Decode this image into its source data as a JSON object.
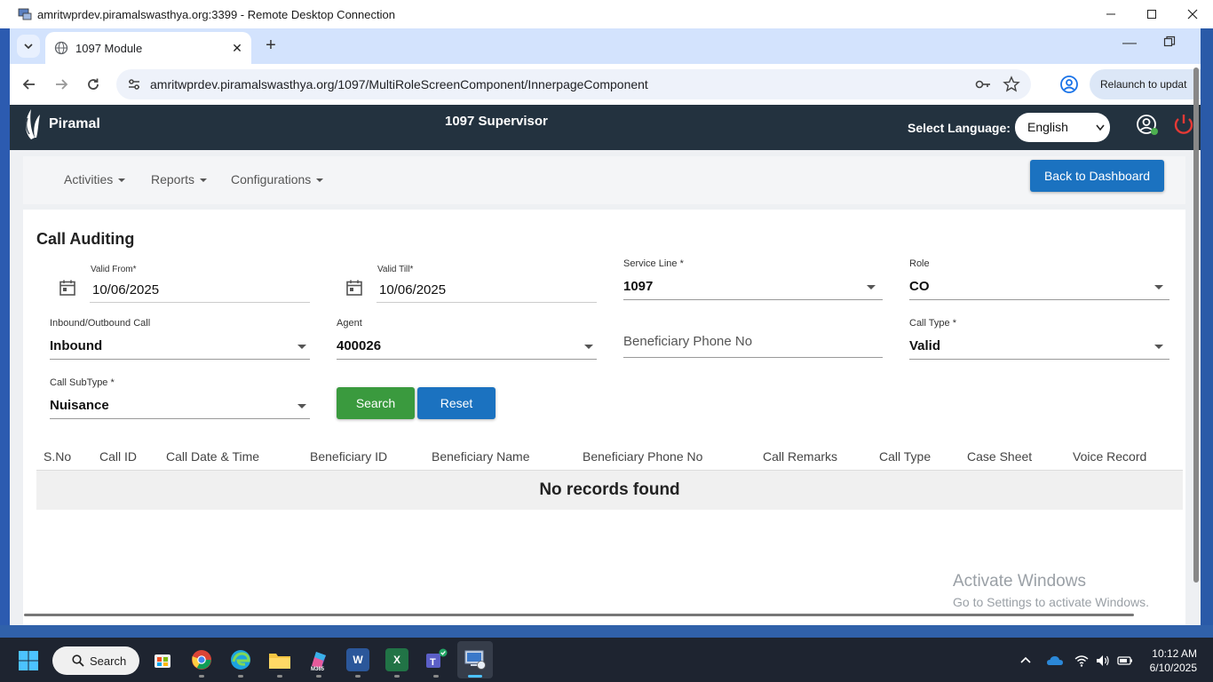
{
  "rdp_window": {
    "title": "amritwprdev.piramalswasthya.org:3399 - Remote Desktop Connection"
  },
  "browser": {
    "tab_title": "1097 Module",
    "url": "amritwprdev.piramalswasthya.org/1097/MultiRoleScreenComponent/InnerpageComponent",
    "relaunch_label": "Relaunch to updat"
  },
  "header": {
    "brand": "Piramal",
    "title": "1097 Supervisor",
    "language_label": "Select Language:",
    "language_value": "English"
  },
  "menu": {
    "items": [
      "Activities",
      "Reports",
      "Configurations"
    ],
    "back_button": "Back to Dashboard"
  },
  "form": {
    "title": "Call Auditing",
    "valid_from": {
      "label": "Valid From*",
      "value": "10/06/2025"
    },
    "valid_till": {
      "label": "Valid Till*",
      "value": "10/06/2025"
    },
    "service_line": {
      "label": "Service Line *",
      "value": "1097"
    },
    "role": {
      "label": "Role",
      "value": "CO"
    },
    "call_direction": {
      "label": "Inbound/Outbound Call",
      "value": "Inbound"
    },
    "agent": {
      "label": "Agent",
      "value": "400026"
    },
    "beneficiary_phone": {
      "placeholder": "Beneficiary Phone No"
    },
    "call_type": {
      "label": "Call Type *",
      "value": "Valid"
    },
    "call_subtype": {
      "label": "Call SubType *",
      "value": "Nuisance"
    },
    "search_button": "Search",
    "reset_button": "Reset"
  },
  "table": {
    "headers": [
      "S.No",
      "Call ID",
      "Call Date & Time",
      "Beneficiary ID",
      "Beneficiary Name",
      "Beneficiary Phone No",
      "Call Remarks",
      "Call Type",
      "Case Sheet",
      "Voice Record"
    ],
    "empty_message": "No records found"
  },
  "watermark": {
    "line1": "Activate Windows",
    "line2": "Go to Settings to activate Windows."
  },
  "taskbar": {
    "search_label": "Search",
    "time": "10:12 AM",
    "date": "6/10/2025"
  },
  "colors": {
    "header_bg": "#23323f",
    "primary_button": "#1b72c0",
    "search_button": "#3a9a3e",
    "tab_strip": "#d3e3fd"
  }
}
